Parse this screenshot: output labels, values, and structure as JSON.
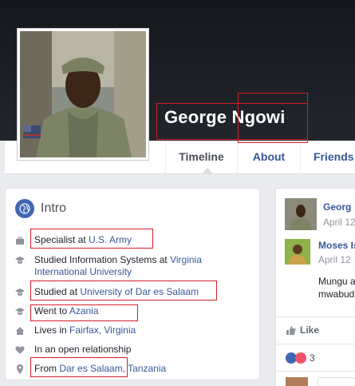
{
  "profile": {
    "name": "George Ngowi"
  },
  "tabs": [
    {
      "label": "Timeline"
    },
    {
      "label": "About"
    },
    {
      "label": "Friends"
    }
  ],
  "intro": {
    "title": "Intro",
    "items": [
      {
        "icon": "briefcase-icon",
        "prefix": "Specialist at ",
        "link": "U.S. Army",
        "suffix": ""
      },
      {
        "icon": "graduation-cap-icon",
        "prefix": "Studied Information Systems at ",
        "link": "Virginia International University",
        "suffix": ""
      },
      {
        "icon": "graduation-cap-icon",
        "prefix": "Studied at ",
        "link": "University of Dar es Salaam",
        "suffix": ""
      },
      {
        "icon": "graduation-cap-icon",
        "prefix": "Went to ",
        "link": "Azania",
        "suffix": ""
      },
      {
        "icon": "house-icon",
        "prefix": "Lives in ",
        "link": "Fairfax, Virginia",
        "suffix": ""
      },
      {
        "icon": "heart-icon",
        "prefix": "In an open relationship",
        "link": "",
        "suffix": ""
      },
      {
        "icon": "location-pin-icon",
        "prefix": "From ",
        "link": "Dar es Salaam,",
        "suffix": " Tanzania"
      }
    ]
  },
  "feed": {
    "post_author": "Georg",
    "post_date": "April 12",
    "comment_author": "Moses Is",
    "comment_date": "April 12",
    "comment_line1": "Mungu a",
    "comment_line2": "mwabud",
    "like_label": "Like",
    "reaction_count": "3"
  },
  "colors": {
    "link": "#365899",
    "annotation_box": "#d21f26",
    "cover": "#1d2129",
    "background": "#e9ebee"
  }
}
